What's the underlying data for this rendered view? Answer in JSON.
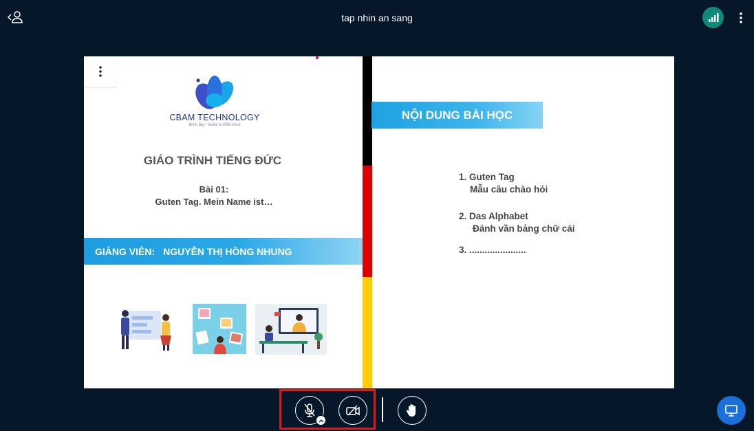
{
  "header": {
    "title": "tap nhin an sang"
  },
  "slide": {
    "logo": {
      "name": "CBAM TECHNOLOGY",
      "tagline": "think big - make a difference"
    },
    "course_title": "GIÁO TRÌNH TIẾNG ĐỨC",
    "lesson_number": "Bài 01:",
    "lesson_name": "Guten Tag. Mein Name ist…",
    "teacher_label": "GIẢNG VIÊN:",
    "teacher_name": "NGUYỄN THỊ HỒNG NHUNG",
    "content_heading": "NỘI DUNG BÀI HỌC",
    "contents": [
      {
        "title": "1. Guten Tag",
        "subtitle": "Mẫu câu chào hỏi"
      },
      {
        "title": "2. Das Alphabet",
        "subtitle": "Đánh vần bảng chữ cái"
      },
      {
        "title": "3. ......................"
      }
    ]
  },
  "controls": {
    "mic": "mic-muted-icon",
    "camera": "camera-off-icon",
    "raise_hand": "hand-icon",
    "presentation": "presentation-icon"
  },
  "colors": {
    "background": "#06172a",
    "connection": "#10897b",
    "accent_blue": "#1e9ee0",
    "highlight_red": "#e0181e",
    "present_button": "#1b6fd9"
  }
}
